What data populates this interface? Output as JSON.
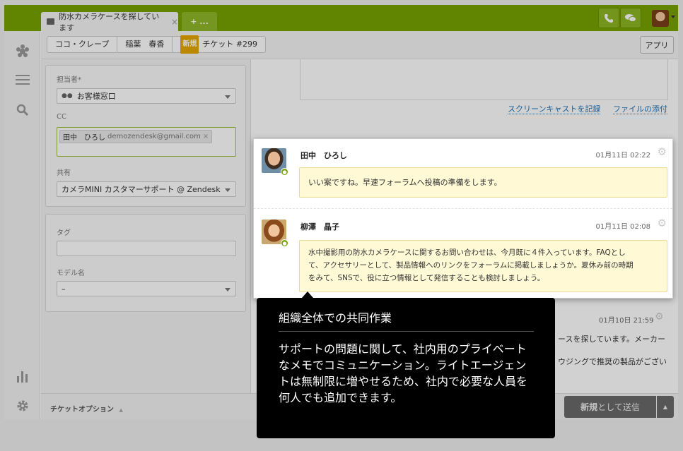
{
  "tabs": [
    {
      "label": "防水カメラケースを探しています",
      "close": "×",
      "icon": "ticket-icon"
    },
    {
      "label": "+ ..."
    }
  ],
  "topbar": {
    "phone_icon": "phone-icon",
    "chat_icon": "chat-icon",
    "avatar": "user-avatar"
  },
  "sidebar": {
    "icons": [
      "zendesk-logo-icon",
      "views-list-icon",
      "search-icon",
      "reports-icon",
      "admin-gear-icon"
    ]
  },
  "breadcrumb": {
    "org": "ココ・クレープ",
    "requester": "稲葉　春香",
    "status_badge": "新規",
    "ticket": "チケット #299"
  },
  "apps_button": "アプリ",
  "form": {
    "assignee_label": "担当者*",
    "assignee_value": "お客様窓口",
    "cc_label": "CC",
    "cc_token_name": "田中　ひろし",
    "cc_token_email": "demozendesk@gmail.com",
    "cc_token_remove": "×",
    "share_label": "共有",
    "share_value": "カメラMINI カスタマーサポート @ Zendesk",
    "tags_label": "タグ",
    "tags_value": "",
    "model_label": "モデル名",
    "model_value": "–"
  },
  "editor_links": {
    "screencast": "スクリーンキャストを記録",
    "attach": "ファイルの添付"
  },
  "comments": [
    {
      "author": "田中　ひろし",
      "time": "01月11日 02:22",
      "body": "いい案ですね。早速フォーラムへ投稿の準備をします。"
    },
    {
      "author": "柳澤　晶子",
      "time": "01月11日 02:08",
      "body_lines": [
        "水中撮影用の防水カメラケースに関するお問い合わせは、今月既に４件入っています。FAQとし",
        "て、アクセサリーとして、製品情報へのリンクをフォーラムに掲載しましょうか。夏休み前の時期",
        "をみて、SNSで、役に立つ情報として発信することも検討しましょう。"
      ]
    }
  ],
  "background_comment": {
    "time": "01月10日 21:59",
    "line1": "ースを探しています。メーカー",
    "line2": "ウジングで推奨の製品がござい"
  },
  "tooltip": {
    "title": "組織全体での共同作業",
    "body": "サポートの問題に関して、社内用のプライベートなメモでコミュニケーション。ライトエージェントは無制限に増やせるため、社内で必要な人員を何人でも追加できます。"
  },
  "bottombar": {
    "ticket_options": "チケットオプション",
    "ticket_options_caret": "▲",
    "submit_prefix": "新規",
    "submit_suffix": "として送信",
    "submit_caret": "▲"
  }
}
